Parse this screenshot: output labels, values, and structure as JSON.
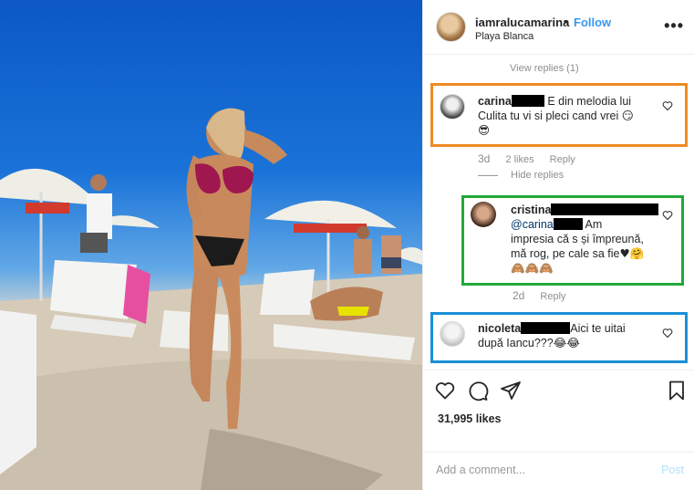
{
  "post": {
    "username": "iamralucamarina",
    "separator": "•",
    "follow_label": "Follow",
    "location": "Playa Blanca",
    "more_label": "•••"
  },
  "photo": {
    "umbrella_brand": "BECK'S",
    "umbrella_price": "35 LEI"
  },
  "comments": {
    "view_replies": "View replies (1)",
    "hide_replies": "Hide replies",
    "items": [
      {
        "user": "carina",
        "text_line1": "E din melodia lui",
        "text_line2": "Culita tu vi si pleci cand vrei",
        "emoji_inline": "😏",
        "emoji_line": "😎",
        "age": "3d",
        "likes": "2 likes",
        "reply_label": "Reply",
        "highlight": "#f08a24"
      },
      {
        "user": "cristina",
        "mention": "@carina",
        "text_line1": "Am",
        "text_line2": "impresia că s și împreună,",
        "text_line3": "mă rog, pe cale sa fie",
        "emoji_inline": "♥🤗",
        "emoji_line": "🙈🙈🙈",
        "age": "2d",
        "reply_label": "Reply",
        "highlight": "#22a83a"
      },
      {
        "user": "nicoleta",
        "text_line1": "Aici te uitai",
        "text_line2": "după Iancu???",
        "emoji_inline": "😂😂",
        "highlight": "#1a8fd6"
      }
    ]
  },
  "actions": {
    "like_icon": "heart-outline-icon",
    "comment_icon": "comment-bubble-icon",
    "share_icon": "paper-plane-icon",
    "save_icon": "bookmark-icon",
    "likes_count": "31,995 likes"
  },
  "composer": {
    "placeholder": "Add a comment...",
    "post_label": "Post"
  }
}
